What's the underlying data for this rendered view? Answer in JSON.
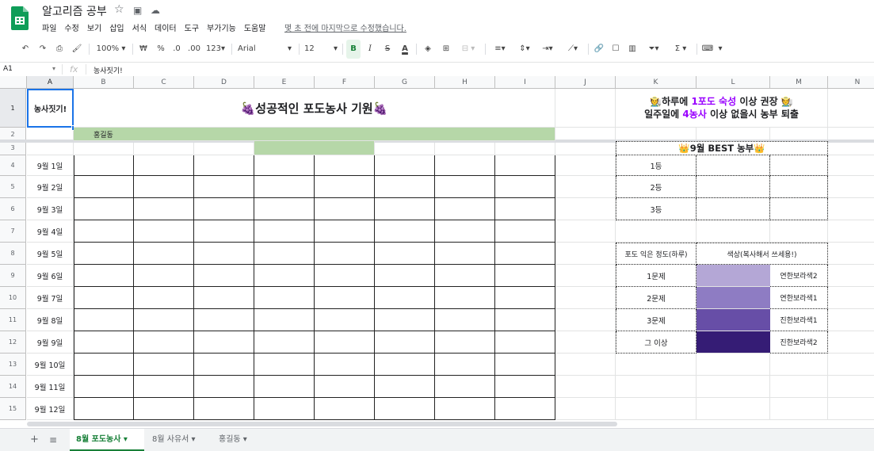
{
  "app": {
    "title": "알고리즘 공부",
    "last_edit": "몇 초 전에 마지막으로 수정했습니다."
  },
  "menu": [
    "파일",
    "수정",
    "보기",
    "삽입",
    "서식",
    "데이터",
    "도구",
    "부가기능",
    "도움말"
  ],
  "toolbar": {
    "zoom": "100%",
    "currency": "₩",
    "percent": "%",
    "dec_less": ".0",
    "dec_more": ".00",
    "number_format": "123",
    "font": "Arial",
    "font_size": "12",
    "bold": "B",
    "italic": "I",
    "strike": "S",
    "text_color": "A",
    "sum": "Σ"
  },
  "formula_bar": {
    "cell_ref": "A1",
    "fx": "fx",
    "value": "농사짓기!"
  },
  "columns": [
    "A",
    "B",
    "C",
    "D",
    "E",
    "F",
    "G",
    "H",
    "I",
    "J",
    "K",
    "L",
    "M",
    "N"
  ],
  "rows": [
    "1",
    "2",
    "3",
    "4",
    "5",
    "6",
    "7",
    "8",
    "9",
    "10",
    "11",
    "12",
    "13",
    "14",
    "15"
  ],
  "sheet": {
    "a1": "농사짓기!",
    "banner_title": "🍇성공적인 포도농사 기원🍇",
    "name_b2": "홍길동",
    "dates": [
      "9월 1일",
      "9월 2일",
      "9월 3일",
      "9월 4일",
      "9월 5일",
      "9월 6일",
      "9월 7일",
      "9월 8일",
      "9월 9일",
      "9월 10일",
      "9월 11일",
      "9월 12일"
    ],
    "notice": {
      "line1_pre": "🧑‍🌾하루에 ",
      "line1_hl": "1포도 숙성",
      "line1_post": " 이상 권장 🧑‍🌾",
      "line2_pre": "일주일에 ",
      "line2_hl": "4농사",
      "line2_post": " 이상 없을시 농부 퇴출"
    },
    "best": {
      "title": "👑9월 BEST 농부👑",
      "ranks": [
        "1등",
        "2등",
        "3등"
      ]
    },
    "legend": {
      "header_left": "포도 익은 정도(하루)",
      "header_right": "색상(복사해서 쓰세용!)",
      "rows": [
        {
          "label": "1문제",
          "color": "#b4a7d6",
          "name": "연한보라색2"
        },
        {
          "label": "2문제",
          "color": "#8e7cc3",
          "name": "연한보라색1"
        },
        {
          "label": "3문제",
          "color": "#674ea7",
          "name": "진한보라색1"
        },
        {
          "label": "그 이상",
          "color": "#351c75",
          "name": "진한보라색2"
        }
      ]
    }
  },
  "tabs": [
    "8월 포도농사",
    "8월 사유서",
    "홍길동"
  ],
  "colors": {
    "green_fill": "#b6d7a8",
    "highlight_purple": "#9900ff",
    "sheets_green": "#188038"
  }
}
